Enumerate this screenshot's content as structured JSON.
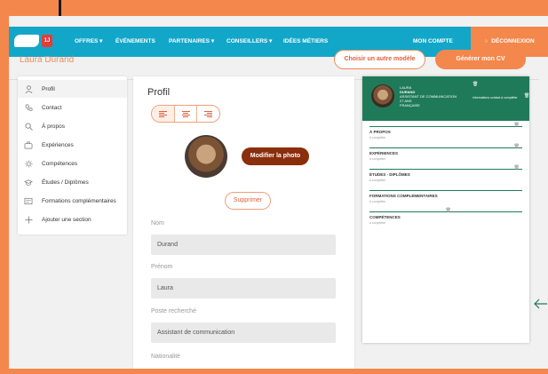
{
  "nav": {
    "items": [
      "OFFRES ▾",
      "ÉVÉNEMENTS",
      "PARTENAIRES ▾",
      "CONSEILLERS ▾",
      "IDÉES MÉTIERS"
    ],
    "account": "MON COMPTE",
    "logout": "DÉCONNEXION",
    "badge": "1J"
  },
  "header": {
    "user_name": "Laura Durand",
    "choose_model": "Choisir un autre modèle",
    "generate": "Générer mon CV"
  },
  "sidebar": {
    "items": [
      {
        "label": "Profil",
        "icon": "user-icon"
      },
      {
        "label": "Contact",
        "icon": "phone-icon"
      },
      {
        "label": "À propos",
        "icon": "search-icon"
      },
      {
        "label": "Expériences",
        "icon": "briefcase-icon"
      },
      {
        "label": "Compétences",
        "icon": "gear-icon"
      },
      {
        "label": "Études / Diplômes",
        "icon": "graduation-icon"
      },
      {
        "label": "Formations complémentaires",
        "icon": "certificate-icon"
      },
      {
        "label": "Ajouter une section",
        "icon": "plus-icon"
      }
    ]
  },
  "profile": {
    "title": "Profil",
    "edit_photo": "Modifier la photo",
    "delete": "Supprimer",
    "fields": [
      {
        "label": "Nom",
        "value": "Durand"
      },
      {
        "label": "Prénom",
        "value": "Laura"
      },
      {
        "label": "Poste recherché",
        "value": "Assistant de communication"
      },
      {
        "label": "Nationalité",
        "value": ""
      }
    ]
  },
  "preview": {
    "first_name": "LAURA",
    "last_name": "DURAND",
    "job": "ASSISTANT DE COMMUNICATION",
    "age": "27 ANS",
    "nationality": "FRANÇAISE",
    "contact_info": "informations contact à compléter",
    "sections": [
      {
        "title": "À PROPOS",
        "sub": "à compléter"
      },
      {
        "title": "EXPÉRIENCES",
        "sub": "à compléter"
      },
      {
        "title": "ÉTUDES - DIPLÔMES",
        "sub": "à compléter"
      },
      {
        "title": "FORMATIONS COMPLÉMENTAIRES",
        "sub": "à compléter"
      },
      {
        "title": "COMPÉTENCES",
        "sub": "à compléter"
      }
    ]
  },
  "colors": {
    "accent": "#f4874b",
    "nav": "#12a7c9",
    "preview_header": "#1f7a5a",
    "photo_button": "#8a2e0c"
  }
}
